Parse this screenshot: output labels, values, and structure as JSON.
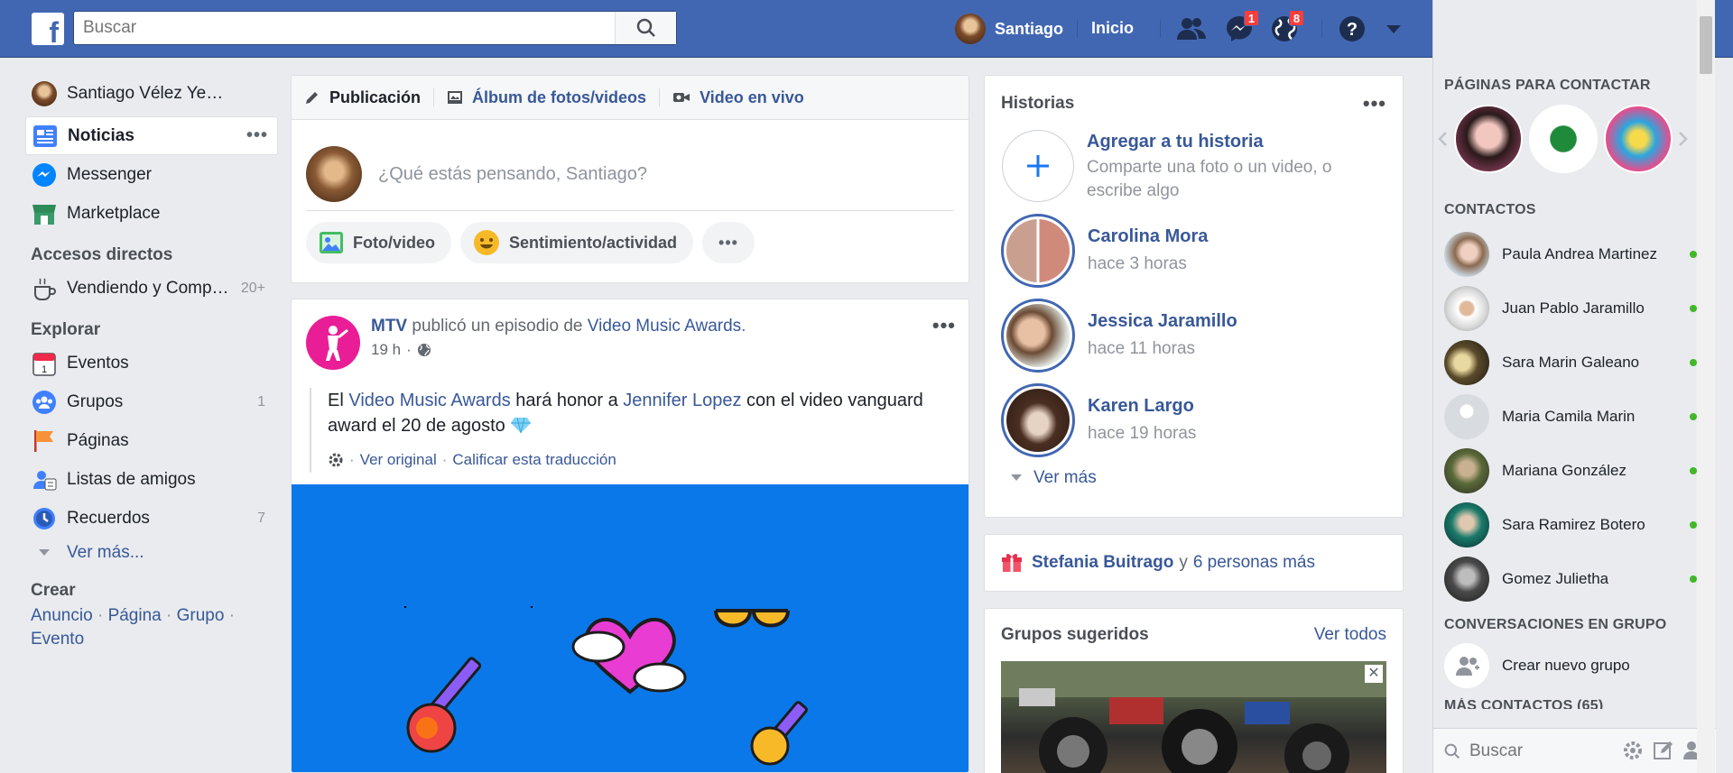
{
  "header": {
    "logo": "f",
    "search_placeholder": "Buscar",
    "user_name": "Santiago",
    "home": "Inicio",
    "messages_badge": "1",
    "notifications_badge": "8",
    "brand_color": "#4267b2"
  },
  "left_nav": {
    "profile_name": "Santiago Vélez Ye…",
    "items": [
      {
        "label": "Noticias",
        "icon": "news-feed-icon"
      },
      {
        "label": "Messenger",
        "icon": "messenger-icon"
      },
      {
        "label": "Marketplace",
        "icon": "marketplace-icon"
      }
    ],
    "shortcuts_title": "Accesos directos",
    "shortcuts": [
      {
        "label": "Vendiendo y Comp…",
        "count": "20+"
      }
    ],
    "explore_title": "Explorar",
    "explore": [
      {
        "label": "Eventos",
        "count": ""
      },
      {
        "label": "Grupos",
        "count": "1"
      },
      {
        "label": "Páginas",
        "count": ""
      },
      {
        "label": "Listas de amigos",
        "count": ""
      },
      {
        "label": "Recuerdos",
        "count": "7"
      }
    ],
    "see_more": "Ver más...",
    "create_title": "Crear",
    "create_links": [
      "Anuncio",
      "Página",
      "Grupo",
      "Evento"
    ]
  },
  "composer": {
    "tabs": [
      "Publicación",
      "Álbum de fotos/videos",
      "Video en vivo"
    ],
    "placeholder": "¿Qué estás pensando, Santiago?",
    "actions": [
      "Foto/video",
      "Sentimiento/actividad"
    ]
  },
  "post": {
    "author": "MTV",
    "action_text": "publicó un episodio de",
    "show": "Video Music Awards",
    "time": "19 h",
    "text_1": "El",
    "link_1": "Video Music Awards",
    "text_2": "hará honor a",
    "link_2": "Jennifer Lopez",
    "text_3": "con el video vanguard award el 20 de agosto",
    "view_original": "Ver original",
    "rate_translation": "Calificar esta traducción",
    "image_bg": "#0b78e9"
  },
  "stories": {
    "title": "Historias",
    "add_title": "Agregar a tu historia",
    "add_sub": "Comparte una foto o un video, o escribe algo",
    "items": [
      {
        "name": "Carolina Mora",
        "time": "hace 3 horas"
      },
      {
        "name": "Jessica Jaramillo",
        "time": "hace 11 horas"
      },
      {
        "name": "Karen Largo",
        "time": "hace 19 horas"
      }
    ],
    "see_more": "Ver más"
  },
  "birthday": {
    "name": "Stefania Buitrago",
    "and": "y",
    "others": "6 personas más"
  },
  "groups": {
    "title": "Grupos sugeridos",
    "see_all": "Ver todos"
  },
  "right_col": {
    "pages_title": "PÁGINAS PARA CONTACTAR",
    "contacts_title": "CONTACTOS",
    "contacts": [
      "Paula Andrea Martinez",
      "Juan Pablo Jaramillo",
      "Sara Marin Galeano",
      "Maria Camila Marin",
      "Mariana González",
      "Sara Ramirez Botero",
      "Gomez Julietha"
    ],
    "group_conv_title": "CONVERSACIONES EN GRUPO",
    "new_group": "Crear nuevo grupo",
    "more_contacts": "MÁS CONTACTOS (65)",
    "chat_search_placeholder": "Buscar",
    "online_color": "#42b72a"
  }
}
